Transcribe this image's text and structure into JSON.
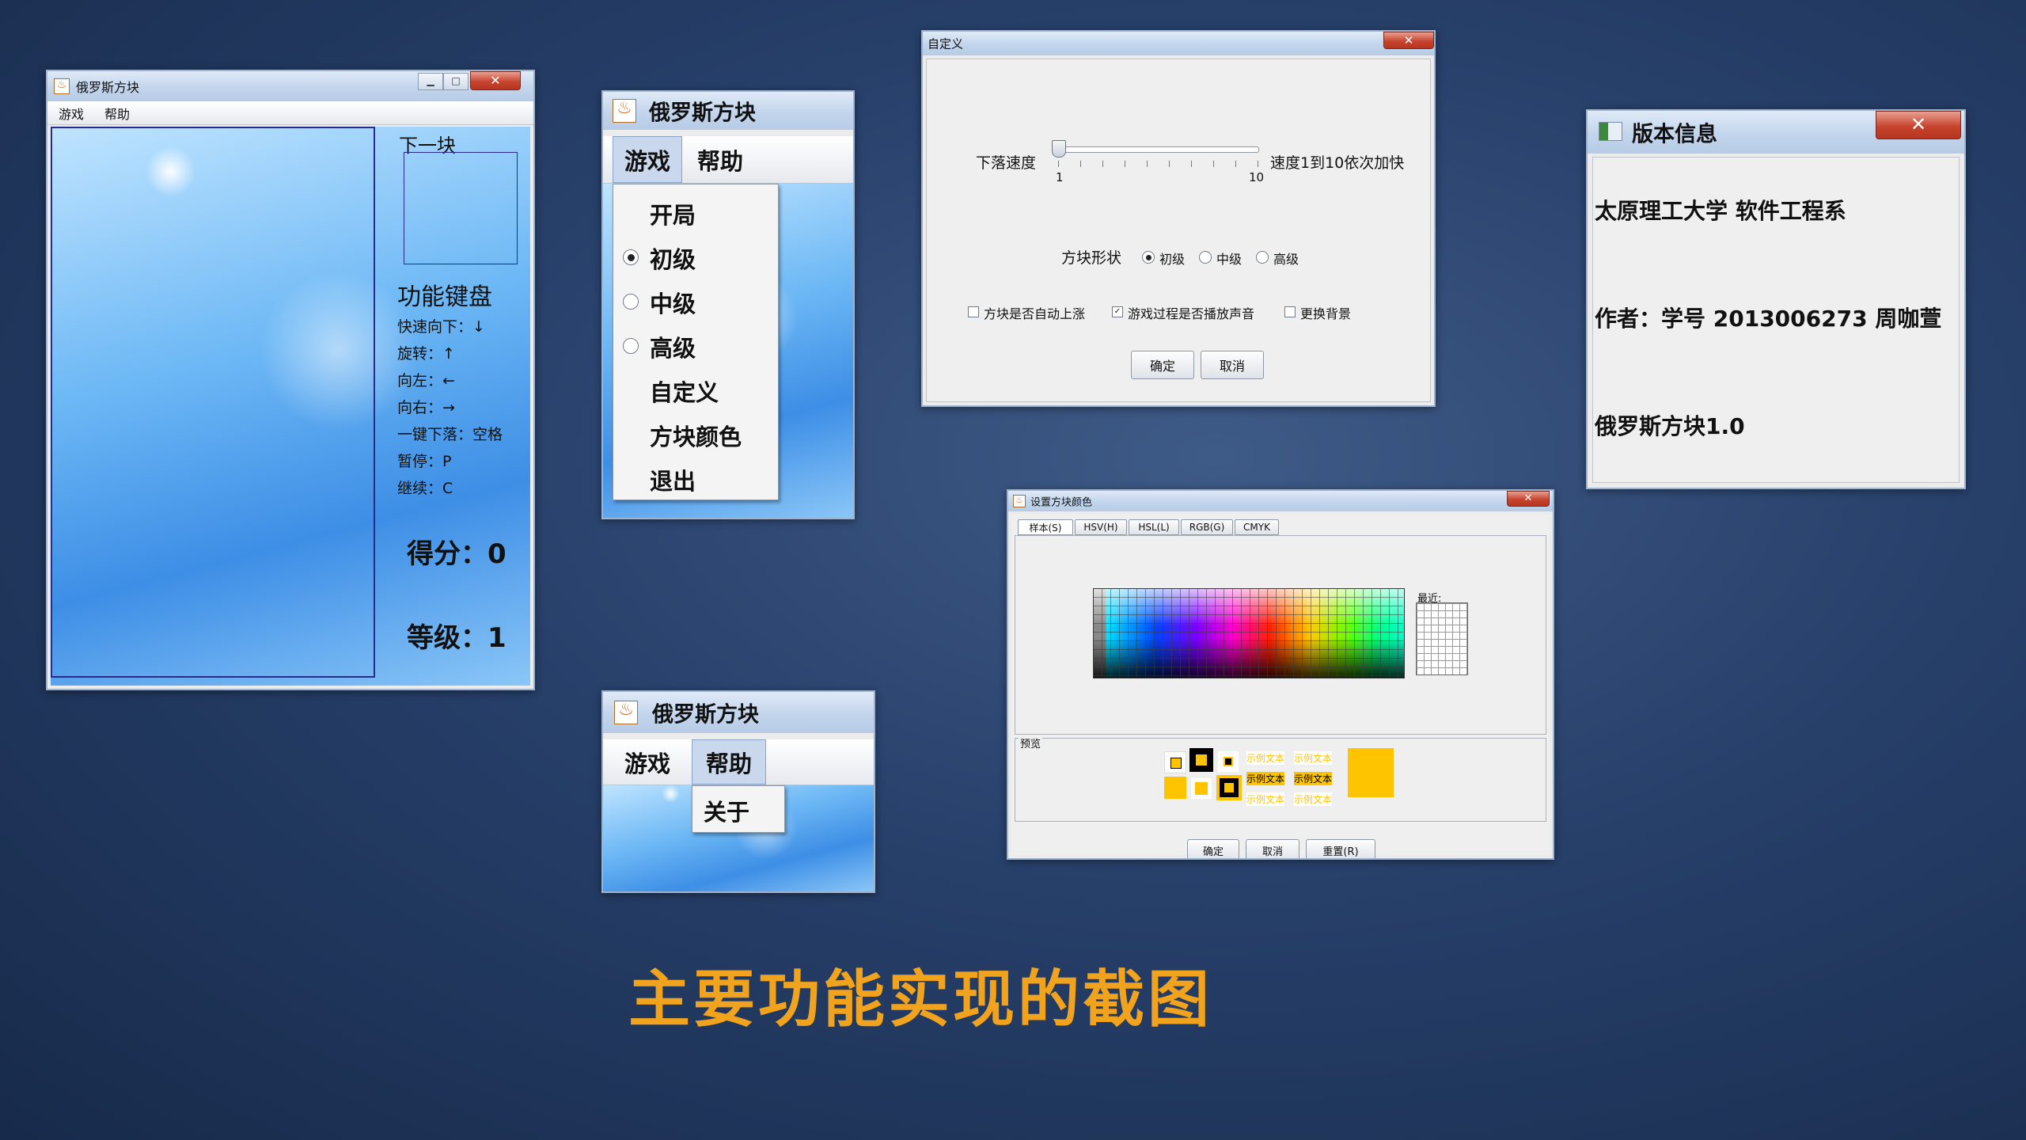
{
  "slide_title": "主要功能实现的截图",
  "colors": {
    "title": "#f2a31d",
    "close": "#c7452f",
    "accent_yellow": "#ffc400"
  },
  "main_window": {
    "title": "俄罗斯方块",
    "menu": [
      "游戏",
      "帮助"
    ],
    "next_block_label": "下一块",
    "keys_heading": "功能键盘",
    "keys": [
      "快速向下：↓",
      "旋转：↑",
      "向左：←",
      "向右：→",
      "一键下落：空格",
      "暂停：P",
      "继续：C"
    ],
    "score_label": "得分：0",
    "level_label": "等级：1"
  },
  "game_menu_window": {
    "title": "俄罗斯方块",
    "menu": [
      "游戏",
      "帮助"
    ],
    "items": [
      {
        "label": "开局",
        "radio": false,
        "selected": false
      },
      {
        "label": "初级",
        "radio": true,
        "selected": true
      },
      {
        "label": "中级",
        "radio": true,
        "selected": false
      },
      {
        "label": "高级",
        "radio": true,
        "selected": false
      },
      {
        "label": "自定义",
        "radio": false,
        "selected": false
      },
      {
        "label": "方块颜色",
        "radio": false,
        "selected": false
      },
      {
        "label": "退出",
        "radio": false,
        "selected": false
      }
    ]
  },
  "help_menu_window": {
    "title": "俄罗斯方块",
    "menu": [
      "游戏",
      "帮助"
    ],
    "items": [
      "关于"
    ]
  },
  "custom_dialog": {
    "title": "自定义",
    "speed_label": "下落速度",
    "slider_min": "1",
    "slider_max": "10",
    "slider_value": 1,
    "speed_hint": "速度1到10依次加快",
    "shape_label": "方块形状",
    "shape_options": [
      "初级",
      "中级",
      "高级"
    ],
    "shape_selected": 0,
    "checkboxes": [
      {
        "label": "方块是否自动上涨",
        "checked": false
      },
      {
        "label": "游戏过程是否播放声音",
        "checked": true
      },
      {
        "label": "更换背景",
        "checked": false
      }
    ],
    "ok": "确定",
    "cancel": "取消"
  },
  "about_window": {
    "title": "版本信息",
    "lines": [
      "太原理工大学 软件工程系",
      "作者：学号 2013006273 周咖萱",
      "俄罗斯方块1.0"
    ]
  },
  "color_dialog": {
    "title": "设置方块颜色",
    "tabs": [
      "样本(S)",
      "HSV(H)",
      "HSL(L)",
      "RGB(G)",
      "CMYK"
    ],
    "recent_label": "最近:",
    "preview_label": "预览",
    "sample_text": "示例文本",
    "buttons": [
      "确定",
      "取消",
      "重置(R)"
    ]
  }
}
